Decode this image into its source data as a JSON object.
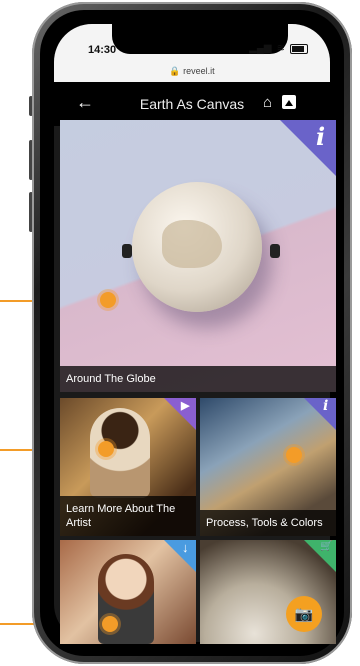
{
  "status_bar": {
    "time": "14:30",
    "url": "reveel.it",
    "signal": "▂▄▆",
    "wifi": "≋"
  },
  "header": {
    "back_icon": "arrow-left-icon",
    "title": "Earth As Canvas",
    "home_icon": "home-icon",
    "gallery_icon": "gallery-icon"
  },
  "tiles": [
    {
      "caption": "Around The Globe",
      "badge": "i",
      "badge_color": "#6a63c9"
    },
    {
      "caption": "Learn More About The Artist",
      "badge": "▶",
      "badge_color": "#8a5fd0"
    },
    {
      "caption": "Process, Tools & Colors",
      "badge": "i",
      "badge_color": "#6a63c9"
    },
    {
      "caption": "",
      "badge": "↓",
      "badge_color": "#4a9be0"
    },
    {
      "caption": "",
      "badge": "🛒",
      "badge_color": "#3fb36b"
    }
  ],
  "camera_button": {
    "icon": "camera-icon",
    "color": "#f4a020"
  },
  "accent_color": "#f39c28"
}
